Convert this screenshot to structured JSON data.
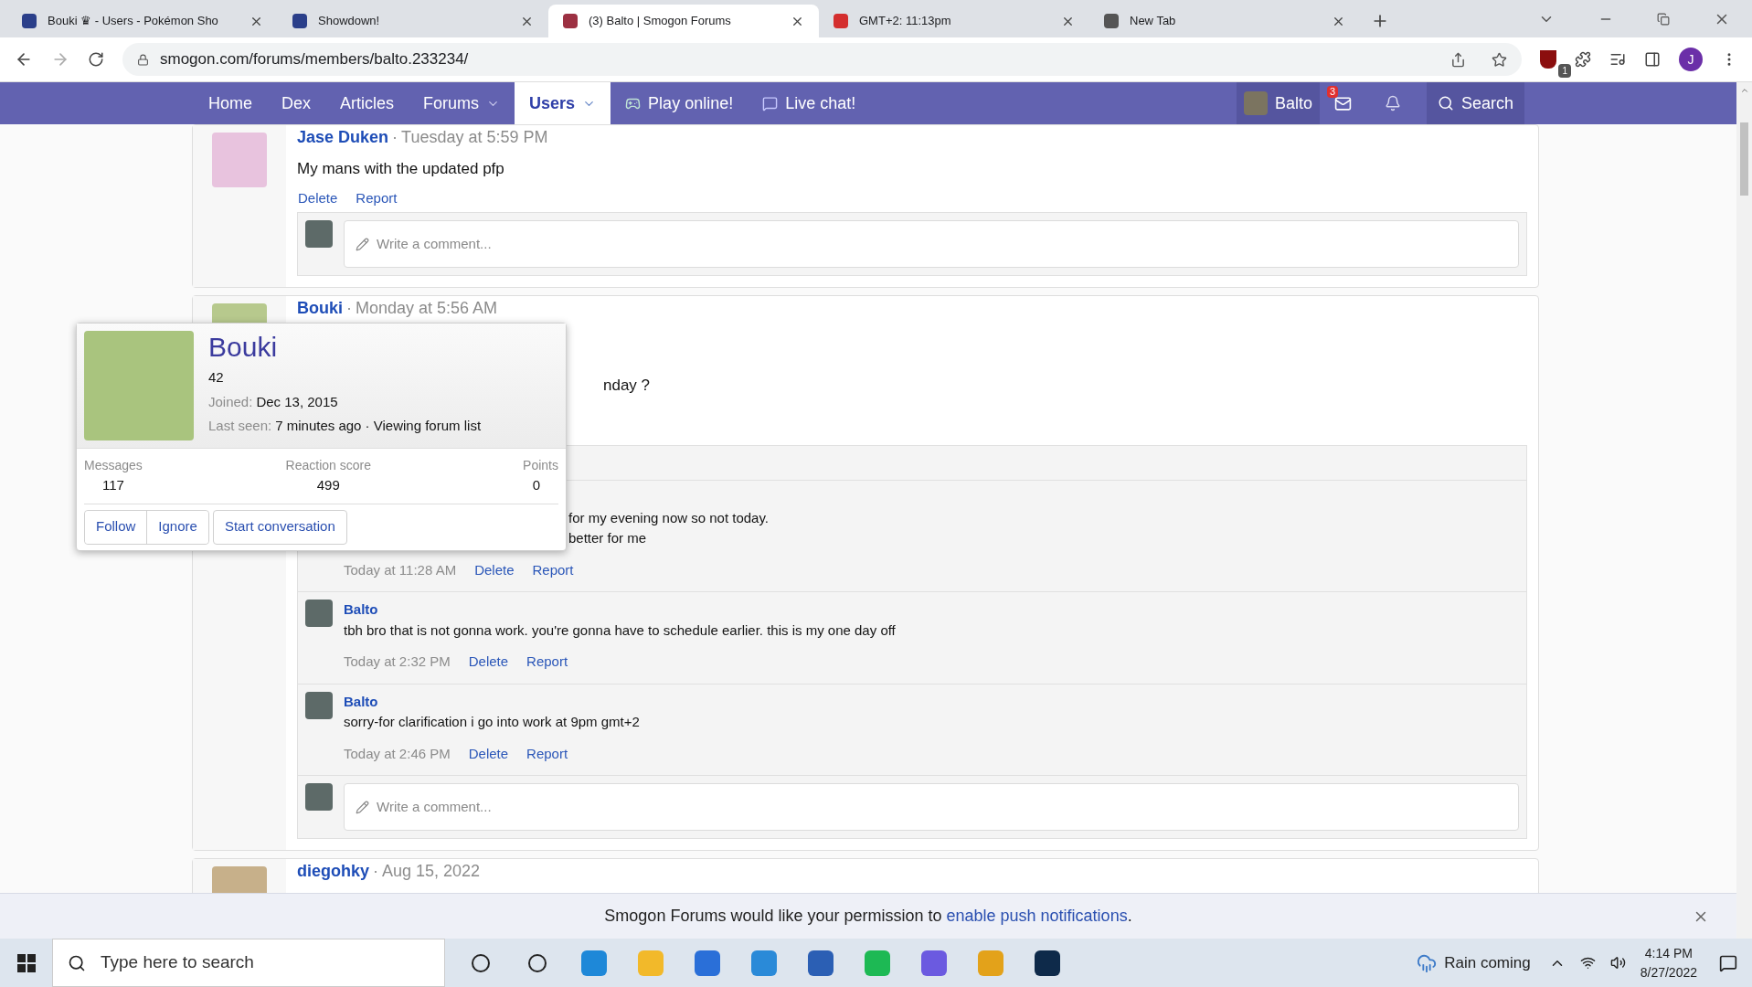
{
  "browser": {
    "tabs": [
      {
        "title": "Bouki ♛ - Users - Pokémon Sho",
        "selected": false
      },
      {
        "title": "Showdown!",
        "selected": false
      },
      {
        "title": "(3) Balto | Smogon Forums",
        "selected": true
      },
      {
        "title": "GMT+2: 11:13pm",
        "selected": false
      },
      {
        "title": "New Tab",
        "selected": false
      }
    ],
    "url": "smogon.com/forums/members/balto.233234/",
    "extension_badge": "1",
    "profile_initial": "J"
  },
  "nav": {
    "items": [
      {
        "label": "Home",
        "kind": "plain",
        "selected": false
      },
      {
        "label": "Dex",
        "kind": "plain",
        "selected": false
      },
      {
        "label": "Articles",
        "kind": "plain",
        "selected": false
      },
      {
        "label": "Forums",
        "kind": "dropdown",
        "selected": false
      },
      {
        "label": "Users",
        "kind": "dropdown",
        "selected": true
      },
      {
        "label": "Play online!",
        "kind": "play",
        "selected": false
      },
      {
        "label": "Live chat!",
        "kind": "chat",
        "selected": false
      }
    ],
    "user": "Balto",
    "inbox_count": "3",
    "search": "Search"
  },
  "posts": [
    {
      "author": "Jase Duken",
      "separator": "·",
      "time": "Tuesday at 5:59 PM",
      "body": "My mans with the updated pfp",
      "actions": [
        "Delete",
        "Report"
      ],
      "comment_placeholder": "Write a comment..."
    },
    {
      "author": "Bouki",
      "separator": "·",
      "time": "Monday at 5:56 AM",
      "body": "nday ?",
      "comments": [
        {
          "lines": [
            "for my evening now so not today.",
            "better for me"
          ],
          "time": "Today at 11:28 AM",
          "actions": [
            "Delete",
            "Report"
          ]
        },
        {
          "author": "Balto",
          "lines": [
            "tbh bro that is not gonna work. you're gonna have to schedule earlier. this is my one day off"
          ],
          "time": "Today at 2:32 PM",
          "actions": [
            "Delete",
            "Report"
          ]
        },
        {
          "author": "Balto",
          "lines": [
            "sorry-for clarification i go into work at 9pm gmt+2"
          ],
          "time": "Today at 2:46 PM",
          "actions": [
            "Delete",
            "Report"
          ]
        }
      ],
      "comment_placeholder": "Write a comment..."
    },
    {
      "author": "diegohky",
      "separator": "·",
      "time": "Aug 15, 2022"
    }
  ],
  "member_card": {
    "name": "Bouki",
    "title": "42",
    "joined_label": "Joined:",
    "joined": "Dec 13, 2015",
    "last_seen_label": "Last seen:",
    "last_seen": "7 minutes ago · Viewing forum list",
    "stats": [
      {
        "label": "Messages",
        "value": "117"
      },
      {
        "label": "Reaction score",
        "value": "499"
      },
      {
        "label": "Points",
        "value": "0"
      }
    ],
    "buttons": [
      "Follow",
      "Ignore",
      "Start conversation"
    ]
  },
  "notification": {
    "text": "Smogon Forums would like your permission to",
    "link": "enable push notifications",
    "end": "."
  },
  "taskbar": {
    "search_placeholder": "Type here to search",
    "weather": "Rain coming",
    "time": "4:14 PM",
    "date": "8/27/2022"
  }
}
